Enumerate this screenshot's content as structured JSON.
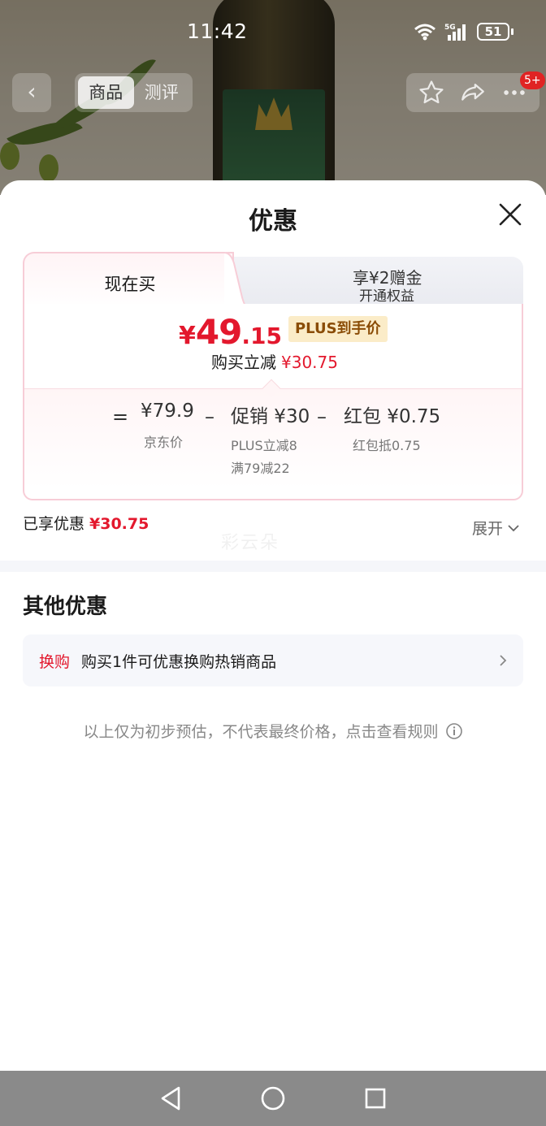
{
  "status_bar": {
    "time": "11:42",
    "network": "5G",
    "battery": "51"
  },
  "top_nav": {
    "tabs": [
      "商品",
      "测评"
    ],
    "badge": "5+"
  },
  "sheet": {
    "title": "优惠",
    "tabs": {
      "active_label": "现在买",
      "other_line1": "享¥2赠金",
      "other_line2": "开通权益"
    },
    "price": {
      "currency": "¥",
      "integer": "49",
      "decimal": ".15",
      "tag": "PLUS到手价"
    },
    "reduce": {
      "label": "购买立减",
      "amount": "¥30.75"
    },
    "calc": {
      "equals": "=",
      "minus": "–",
      "base_price": "¥79.9",
      "base_label": "京东价",
      "promo_value": "促销 ¥30",
      "promo_sub1": "PLUS立减8",
      "promo_sub2": "满79减22",
      "redpacket_value": "红包 ¥0.75",
      "redpacket_sub": "红包抵0.75"
    },
    "enjoyed": {
      "label": "已享优惠",
      "amount": "¥30.75"
    },
    "expand_label": "展开",
    "watermark": "彩云朵",
    "other_section": {
      "title": "其他优惠",
      "swap_tag": "换购",
      "swap_text": "购买1件可优惠换购热销商品"
    },
    "disclaimer": "以上仅为初步预估，不代表最终价格，点击查看规则"
  },
  "colors": {
    "accent_red": "#e3182d",
    "plus_gold": "#8a4c06",
    "card_border": "#f7cdd7"
  }
}
